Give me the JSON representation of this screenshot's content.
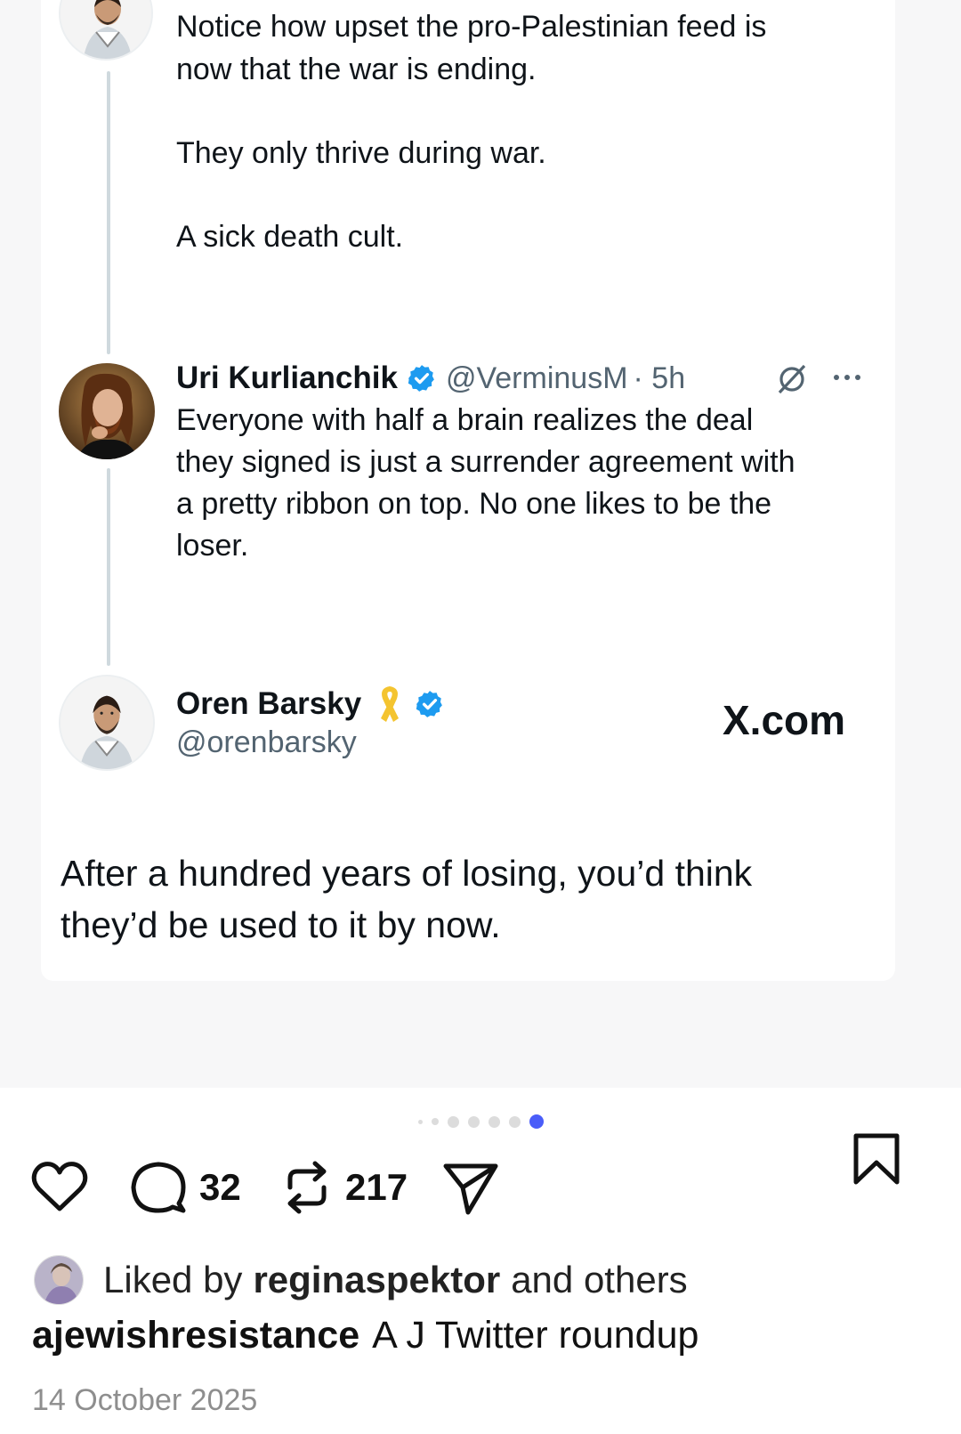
{
  "thread": {
    "top_tweet": {
      "lines": [
        "Notice how upset the pro-Palestinian feed is",
        "now that the war is ending."
      ],
      "para2": "They only thrive during war.",
      "para3": "A sick death cult."
    },
    "reply": {
      "name": "Uri Kurlianchik",
      "handle": "@VerminusM",
      "time": "· 5h",
      "text_lines": [
        "Everyone with half a brain realizes the deal",
        "they signed is just a surrender agreement with",
        "a pretty ribbon on top. No one likes to be the",
        "loser."
      ]
    },
    "quote": {
      "name": "Oren Barsky",
      "handle": "@orenbarsky",
      "watermark": "X.com",
      "text_lines": [
        "After a hundred years of losing, you’d think",
        "they’d be used to it by now."
      ]
    }
  },
  "carousel": {
    "dots": 7,
    "active_index": 6
  },
  "actions": {
    "comments": "32",
    "reposts": "217"
  },
  "likes": {
    "prefix": "Liked by",
    "user": "reginaspektor",
    "suffix": "and others"
  },
  "caption": {
    "user": "ajewishresistance",
    "text": "A J Twitter roundup"
  },
  "date": "14 October 2025",
  "colors": {
    "verified": "#1d9bf0",
    "ribbon": "#f4c430",
    "active_dot": "#4a5df9",
    "thread_line": "#cfd9de"
  }
}
